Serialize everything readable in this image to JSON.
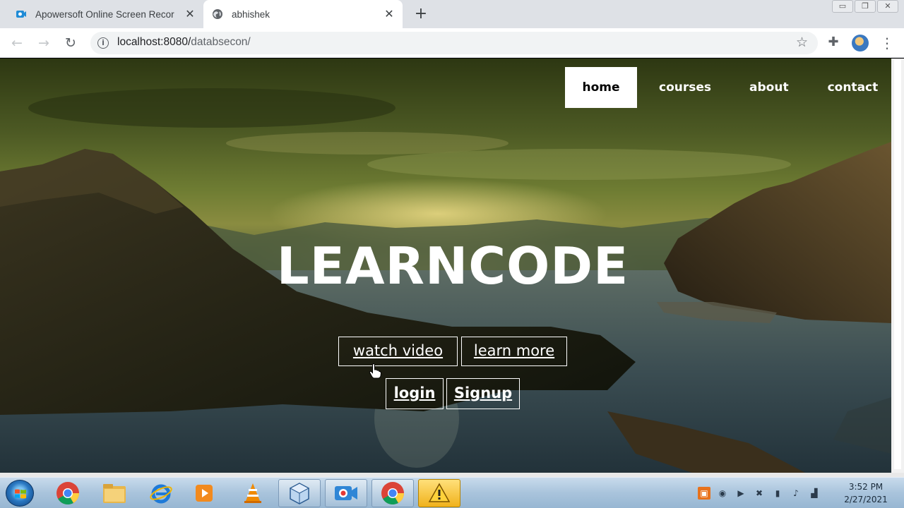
{
  "browser": {
    "tabs": [
      {
        "title": "Apowersoft Online Screen Recor",
        "icon": "recorder-icon",
        "active": false
      },
      {
        "title": "abhishek",
        "icon": "globe-icon",
        "active": true
      }
    ],
    "url_host": "localhost:8080/",
    "url_path": "databsecon/"
  },
  "page": {
    "nav": {
      "home": "home",
      "courses": "courses",
      "about": "about",
      "contact": "contact"
    },
    "hero_title": "LEARNCODE",
    "buttons": {
      "watch_video": "watch video",
      "learn_more": "learn more",
      "login": "login",
      "signup": "Signup"
    }
  },
  "taskbar": {
    "time": "3:52 PM",
    "date": "2/27/2021"
  }
}
